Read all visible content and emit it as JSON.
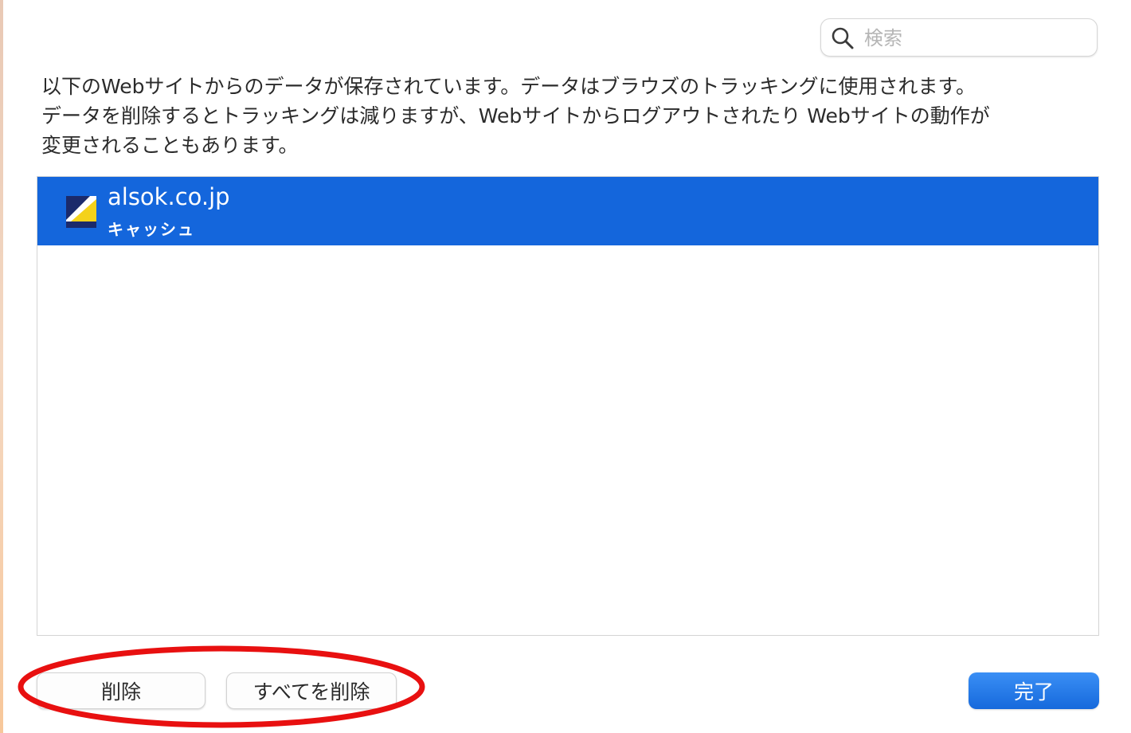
{
  "search": {
    "placeholder": "検索",
    "value": "",
    "icon": "search-icon"
  },
  "description": {
    "lines": [
      "以下のWebサイトからのデータが保存されています。データはブラウズのトラッキングに使用されます。",
      "データを削除するとトラッキングは減りますが、Webサイトからログアウトされたり Webサイトの動作が",
      "変更されることもあります。"
    ]
  },
  "sites": [
    {
      "domain": "alsok.co.jp",
      "data_type": "キャッシュ",
      "selected": true,
      "icon": "alsok-favicon-icon"
    }
  ],
  "buttons": {
    "delete": "削除",
    "delete_all": "すべてを削除",
    "done": "完了"
  },
  "colors": {
    "selection": "#1466dc",
    "primary_button": "#1a6fe0",
    "highlight_ring": "#e81010"
  }
}
